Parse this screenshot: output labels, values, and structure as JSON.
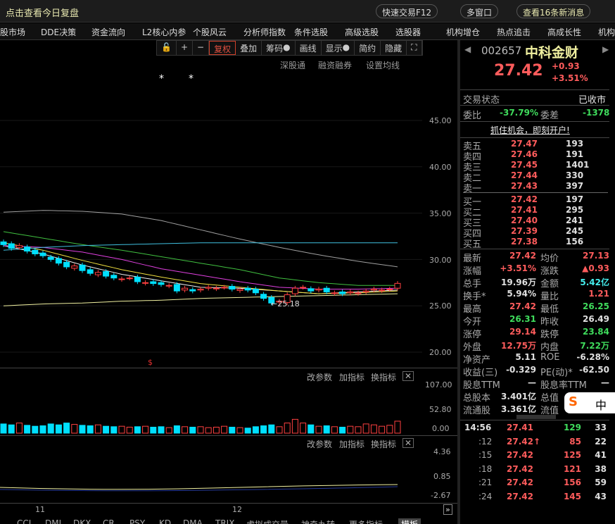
{
  "titlebar": {
    "title": "点击查看今日复盘",
    "quick_trade": "快速交易F12",
    "multi_window": "多窗口",
    "messages": "查看16条新消息",
    "close": "X"
  },
  "menu": [
    "股市场",
    "DDE决策",
    "资金流向",
    "L2核心内参",
    "个股风云",
    "分析师指数",
    "条件选股",
    "高级选股",
    "选股器",
    "机构增仓",
    "热点追击",
    "高成长性",
    "机构"
  ],
  "toolbar": [
    "+",
    "−",
    "复权",
    "叠加",
    "筹码",
    "画线",
    "显示",
    "简约",
    "隐藏"
  ],
  "subtoolbar": [
    "深股通",
    "融资融券",
    "设置均线"
  ],
  "stock": {
    "code": "002657",
    "name": "中科金财",
    "price": "27.42",
    "change": "+0.93",
    "change_pct": "+3.51%"
  },
  "status": {
    "label": "交易状态",
    "value": "已收市",
    "wb_label": "委比",
    "wb": "-37.79%",
    "wc_label": "委差",
    "wc": "-1378",
    "promo": "抓住机会，即刻开户!"
  },
  "asks": [
    {
      "l": "卖五",
      "p": "27.47",
      "v": "193"
    },
    {
      "l": "卖四",
      "p": "27.46",
      "v": "191"
    },
    {
      "l": "卖三",
      "p": "27.45",
      "v": "1401"
    },
    {
      "l": "卖二",
      "p": "27.44",
      "v": "330"
    },
    {
      "l": "卖一",
      "p": "27.43",
      "v": "397"
    }
  ],
  "bids": [
    {
      "l": "买一",
      "p": "27.42",
      "v": "197"
    },
    {
      "l": "买二",
      "p": "27.41",
      "v": "295"
    },
    {
      "l": "买三",
      "p": "27.40",
      "v": "241"
    },
    {
      "l": "买四",
      "p": "27.39",
      "v": "245"
    },
    {
      "l": "买五",
      "p": "27.38",
      "v": "156"
    }
  ],
  "quote": [
    {
      "a": "最新",
      "av": "27.42",
      "ac": "red",
      "b": "均价",
      "bv": "27.13",
      "bc": "red"
    },
    {
      "a": "涨幅",
      "av": "+3.51%",
      "ac": "red",
      "b": "涨跌",
      "bv": "▲0.93",
      "bc": "red"
    },
    {
      "a": "总手",
      "av": "19.96万",
      "ac": "wht",
      "b": "金额",
      "bv": "5.42亿",
      "bc": "cyan"
    },
    {
      "a": "换手*",
      "av": "5.94%",
      "ac": "wht",
      "b": "量比",
      "bv": "1.21",
      "bc": "red"
    },
    {
      "a": "最高",
      "av": "27.42",
      "ac": "red",
      "b": "最低",
      "bv": "26.25",
      "bc": "grn"
    },
    {
      "a": "今开",
      "av": "26.31",
      "ac": "grn",
      "b": "昨收",
      "bv": "26.49",
      "bc": "wht"
    },
    {
      "a": "涨停",
      "av": "29.14",
      "ac": "red",
      "b": "跌停",
      "bv": "23.84",
      "bc": "grn"
    },
    {
      "a": "外盘",
      "av": "12.75万",
      "ac": "red",
      "b": "内盘",
      "bv": "7.22万",
      "bc": "grn"
    },
    {
      "a": "净资产",
      "av": "5.11",
      "ac": "wht",
      "b": "ROE",
      "bv": "-6.28%",
      "bc": "wht"
    },
    {
      "a": "收益(三)",
      "av": "-0.329",
      "ac": "wht",
      "b": "PE(动)*",
      "bv": "-62.50",
      "bc": "wht"
    },
    {
      "a": "股息TTM",
      "av": "—",
      "ac": "wht",
      "b": "股息率TTM",
      "bv": "—",
      "bc": "wht"
    },
    {
      "a": "总股本",
      "av": "3.401亿",
      "ac": "wht",
      "b": "总值",
      "bv": "",
      "bc": "wht"
    },
    {
      "a": "流通股",
      "av": "3.361亿",
      "ac": "wht",
      "b": "流值",
      "bv": "",
      "bc": "wht"
    }
  ],
  "ime": {
    "logo": "S",
    "mode": "中"
  },
  "ticks": [
    {
      "t": "14:56",
      "p": "27.41",
      "v": "129",
      "vc": "grn",
      "n": "33"
    },
    {
      "t": ":12",
      "p": "27.42↑",
      "v": "85",
      "vc": "red",
      "n": "22"
    },
    {
      "t": ":15",
      "p": "27.42",
      "v": "125",
      "vc": "red",
      "n": "41"
    },
    {
      "t": ":18",
      "p": "27.42",
      "v": "121",
      "vc": "red",
      "n": "38"
    },
    {
      "t": ":21",
      "p": "27.42",
      "v": "156",
      "vc": "red",
      "n": "59"
    },
    {
      "t": ":24",
      "p": "27.42",
      "v": "145",
      "vc": "red",
      "n": "43"
    }
  ],
  "price_axis": [
    "45.00",
    "40.00",
    "35.00",
    "30.00",
    "25.00",
    "20.00"
  ],
  "low_marker": "←25.18",
  "vol_panel": {
    "buttons": [
      "改参数",
      "加指标",
      "换指标"
    ],
    "axis": [
      "107.00",
      "52.80",
      "0.00"
    ]
  },
  "ind_panel": {
    "buttons": [
      "改参数",
      "加指标",
      "换指标"
    ],
    "axis": [
      "4.36",
      "0.85",
      "-2.67"
    ]
  },
  "date_axis": [
    "11",
    "12"
  ],
  "bottom_tabs": [
    "CCI",
    "DMI",
    "DKX",
    "CR",
    "PSY",
    "KD",
    "DMA",
    "TRIX",
    "虚拟成交量",
    "神奇九转",
    "更多指标",
    "模板"
  ],
  "chart_data": {
    "type": "candlestick",
    "ylim": [
      20,
      45
    ],
    "closes": [
      31.6,
      31.2,
      31.5,
      30.9,
      30.6,
      30.4,
      30.0,
      29.6,
      29.2,
      29.3,
      28.8,
      28.5,
      28.6,
      28.2,
      28.0,
      27.9,
      28.0,
      27.6,
      27.5,
      27.4,
      27.3,
      27.2,
      26.6,
      26.9,
      26.6,
      26.8,
      27.0,
      26.9,
      27.0,
      26.8,
      26.8,
      26.7,
      26.4,
      25.8,
      25.3,
      25.5,
      26.2,
      26.9,
      27.0,
      26.6,
      26.8,
      26.5,
      26.4,
      26.3,
      26.5,
      26.4,
      26.6,
      26.8,
      26.7,
      26.8,
      27.42
    ],
    "ma_series": [
      {
        "name": "MA5",
        "color": "#f0f0f0",
        "values": [
          31.5,
          30.6,
          29.4,
          28.4,
          27.7,
          27.0,
          26.9,
          26.6,
          26.3,
          26.5,
          26.7
        ]
      },
      {
        "name": "MA10",
        "color": "#f0e040",
        "values": [
          31.8,
          31.0,
          29.9,
          28.9,
          28.1,
          27.4,
          27.0,
          26.6,
          26.3,
          26.4,
          26.6
        ]
      },
      {
        "name": "MA20",
        "color": "#e040e0",
        "values": [
          31.5,
          31.3,
          30.8,
          30.0,
          29.0,
          28.3,
          27.6,
          27.0,
          26.8,
          26.8,
          26.9
        ]
      },
      {
        "name": "MA30",
        "color": "#40c040",
        "values": [
          33.0,
          32.3,
          31.6,
          31.0,
          30.3,
          29.6,
          28.9,
          28.0,
          27.5,
          27.2,
          27.2
        ]
      },
      {
        "name": "MA60",
        "color": "#a0a0a0",
        "values": [
          35.1,
          35.3,
          35.2,
          34.9,
          34.2,
          33.2,
          32.2,
          31.3,
          30.5,
          29.8,
          29.2
        ]
      },
      {
        "name": "MA120",
        "color": "#40c0e0",
        "values": [
          31.0,
          31.3,
          31.5,
          31.6,
          31.7,
          31.8,
          31.8,
          31.8,
          31.8,
          31.8,
          31.8
        ]
      },
      {
        "name": "MA250",
        "color": "#f0f0a0",
        "values": [
          25.0,
          25.2,
          25.3,
          25.5,
          25.6,
          25.8,
          25.9,
          26.0,
          26.1,
          26.2,
          26.3
        ]
      }
    ],
    "volumes": [
      20,
      18,
      22,
      17,
      15,
      16,
      20,
      18,
      22,
      19,
      17,
      16,
      18,
      15,
      14,
      15,
      13,
      14,
      15,
      13,
      14,
      12,
      16,
      14,
      13,
      14,
      12,
      13,
      15,
      13,
      12,
      11,
      14,
      16,
      18,
      14,
      22,
      30,
      22,
      18,
      15,
      16,
      14,
      13,
      15,
      14,
      20,
      18,
      15,
      17,
      26
    ]
  }
}
